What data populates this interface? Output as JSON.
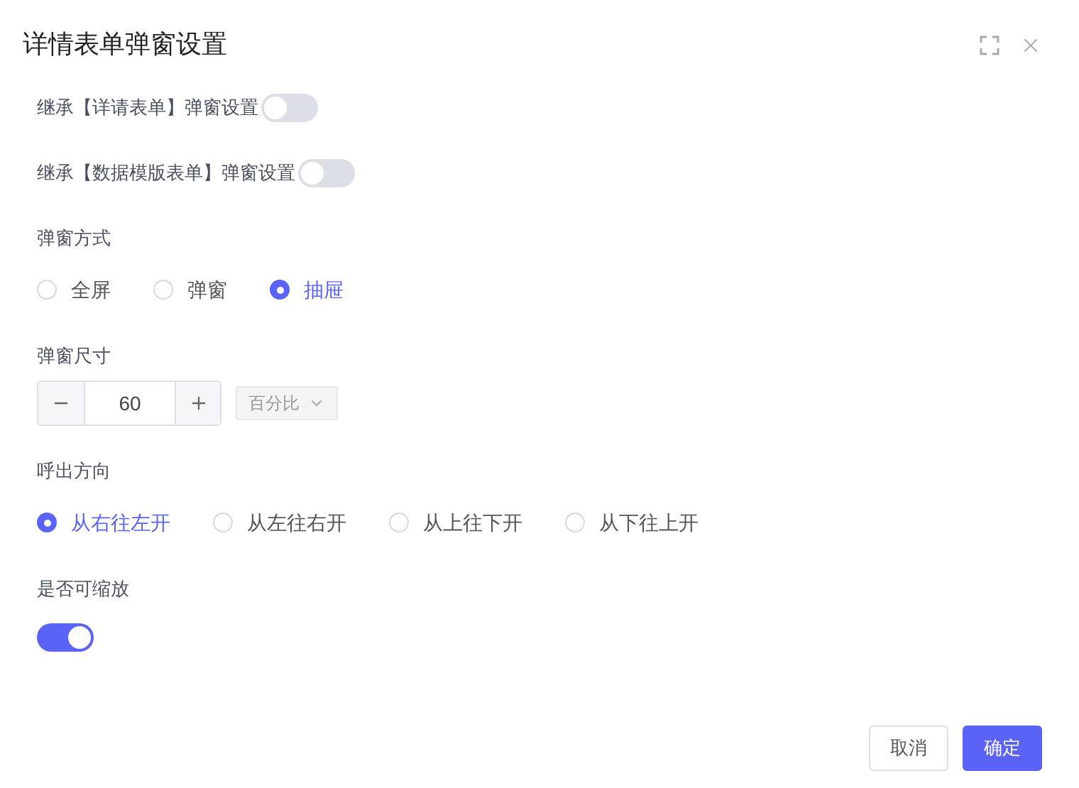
{
  "dialog": {
    "title": "详情表单弹窗设置"
  },
  "inherit_settings": [
    {
      "label": "继承【详请表单】弹窗设置",
      "on": false
    },
    {
      "label": "继承【数据模版表单】弹窗设置",
      "on": false
    }
  ],
  "popup_mode": {
    "label": "弹窗方式",
    "options": [
      {
        "label": "全屏",
        "selected": false
      },
      {
        "label": "弹窗",
        "selected": false
      },
      {
        "label": "抽屉",
        "selected": true
      }
    ]
  },
  "popup_size": {
    "label": "弹窗尺寸",
    "value": "60",
    "unit": "百分比"
  },
  "open_direction": {
    "label": "呼出方向",
    "options": [
      {
        "label": "从右往左开",
        "selected": true
      },
      {
        "label": "从左往右开",
        "selected": false
      },
      {
        "label": "从上往下开",
        "selected": false
      },
      {
        "label": "从下往上开",
        "selected": false
      }
    ]
  },
  "resizable": {
    "label": "是否可缩放",
    "on": true
  },
  "buttons": [
    {
      "label": "取消",
      "kind": "secondary"
    },
    {
      "label": "确定",
      "kind": "primary"
    }
  ]
}
